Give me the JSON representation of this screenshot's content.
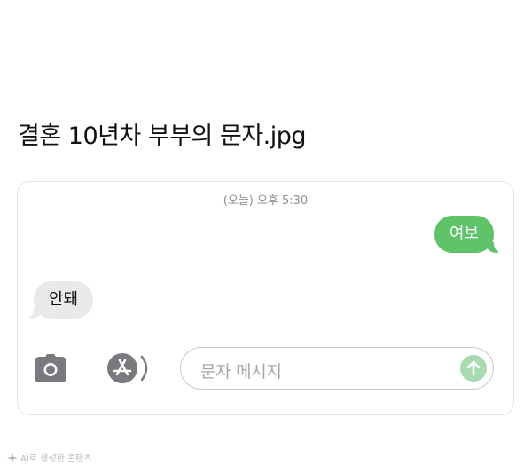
{
  "post": {
    "title": "결혼 10년차 부부의 문자.jpg"
  },
  "conversation": {
    "timestamp": "(오늘) 오후 5:30",
    "messages": [
      {
        "direction": "sent",
        "text": "여보"
      },
      {
        "direction": "received",
        "text": "안돼"
      }
    ]
  },
  "composer": {
    "placeholder": "문자 메시지",
    "icons": {
      "camera": "camera-icon",
      "apps": "app-store-icon",
      "send": "arrow-up-icon"
    },
    "colors": {
      "sent_bubble": "#5fc36a",
      "received_bubble": "#e9e9eb",
      "send_button": "#a8dcb0"
    }
  },
  "footer": {
    "watermark": "AI로 생성한 콘텐츠",
    "watermark_icon": "ai-sparkle-icon"
  }
}
